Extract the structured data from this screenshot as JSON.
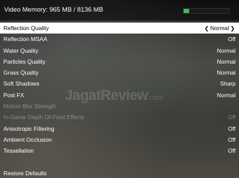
{
  "header": {
    "vram_text": "Video Memory: 965 MB / 8136 MB",
    "vram_used_fraction": 0.1186,
    "vram_bar_color": "#3fbf4f"
  },
  "watermark": {
    "main": "JagatReview",
    "suffix": ".com"
  },
  "settings": [
    {
      "label": "Reflection Quality",
      "value": "Normal",
      "selected": true,
      "disabled": false
    },
    {
      "label": "Reflection MSAA",
      "value": "Off",
      "selected": false,
      "disabled": false
    },
    {
      "label": "Water Quality",
      "value": "Normal",
      "selected": false,
      "disabled": false
    },
    {
      "label": "Particles Quality",
      "value": "Normal",
      "selected": false,
      "disabled": false
    },
    {
      "label": "Grass Quality",
      "value": "Normal",
      "selected": false,
      "disabled": false
    },
    {
      "label": "Soft Shadows",
      "value": "Sharp",
      "selected": false,
      "disabled": false
    },
    {
      "label": "Post FX",
      "value": "Normal",
      "selected": false,
      "disabled": false
    },
    {
      "label": "Motion Blur Strength",
      "value": "",
      "selected": false,
      "disabled": true
    },
    {
      "label": "In-Game Depth Of Field Effects",
      "value": "Off",
      "selected": false,
      "disabled": true
    },
    {
      "label": "Anisotropic Filtering",
      "value": "Off",
      "selected": false,
      "disabled": false
    },
    {
      "label": "Ambient Occlusion",
      "value": "Off",
      "selected": false,
      "disabled": false
    },
    {
      "label": "Tessellation",
      "value": "Off",
      "selected": false,
      "disabled": false
    }
  ],
  "footer": {
    "restore_label": "Restore Defaults"
  }
}
